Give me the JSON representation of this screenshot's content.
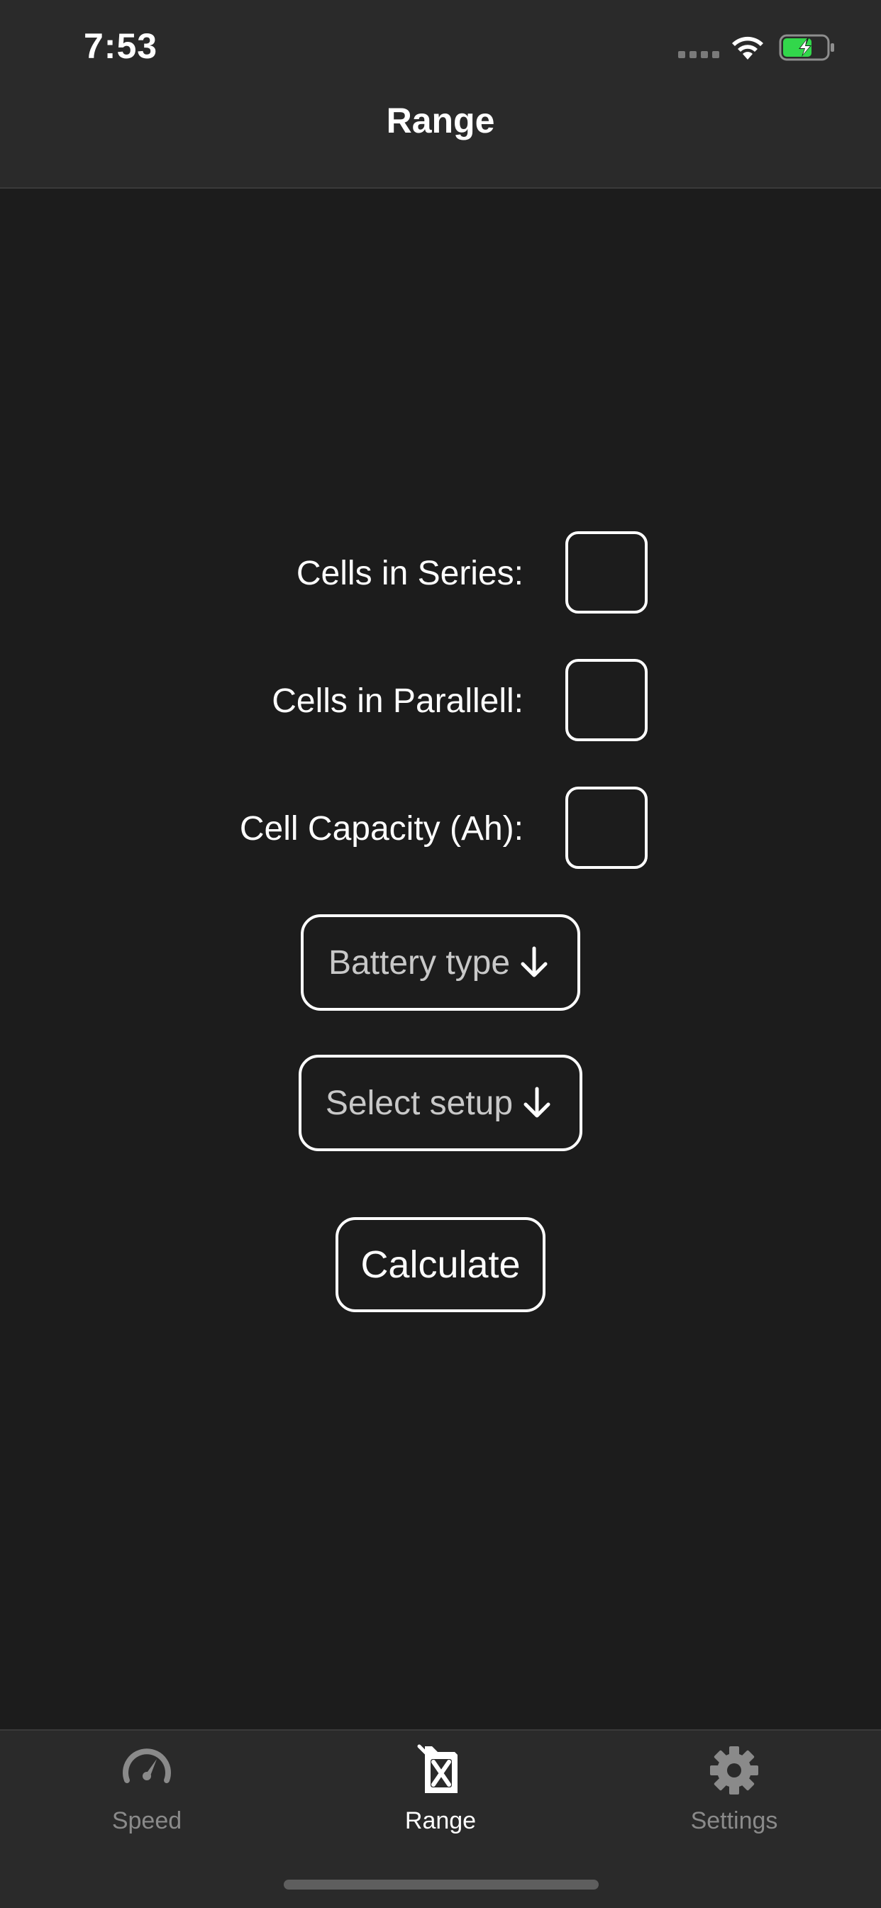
{
  "status_bar": {
    "time": "7:53",
    "wifi_icon": "wifi-icon",
    "battery_icon": "battery-charging-icon",
    "battery_color": "#32d74b"
  },
  "nav": {
    "title": "Range"
  },
  "form": {
    "fields": [
      {
        "label": "Cells in Series:",
        "value": ""
      },
      {
        "label": "Cells in Parallell:",
        "value": ""
      },
      {
        "label": "Cell Capacity (Ah):",
        "value": ""
      }
    ],
    "battery_type": {
      "label": "Battery type",
      "icon": "arrow-down-icon"
    },
    "select_setup": {
      "label": "Select setup",
      "icon": "arrow-down-icon"
    },
    "calculate": "Calculate"
  },
  "tab_bar": {
    "active_color": "#ffffff",
    "inactive_color": "#8a8a8a",
    "tabs": [
      {
        "label": "Speed",
        "icon": "speedometer-icon",
        "active": false
      },
      {
        "label": "Range",
        "icon": "fuel-can-icon",
        "active": true
      },
      {
        "label": "Settings",
        "icon": "gear-icon",
        "active": false
      }
    ]
  }
}
